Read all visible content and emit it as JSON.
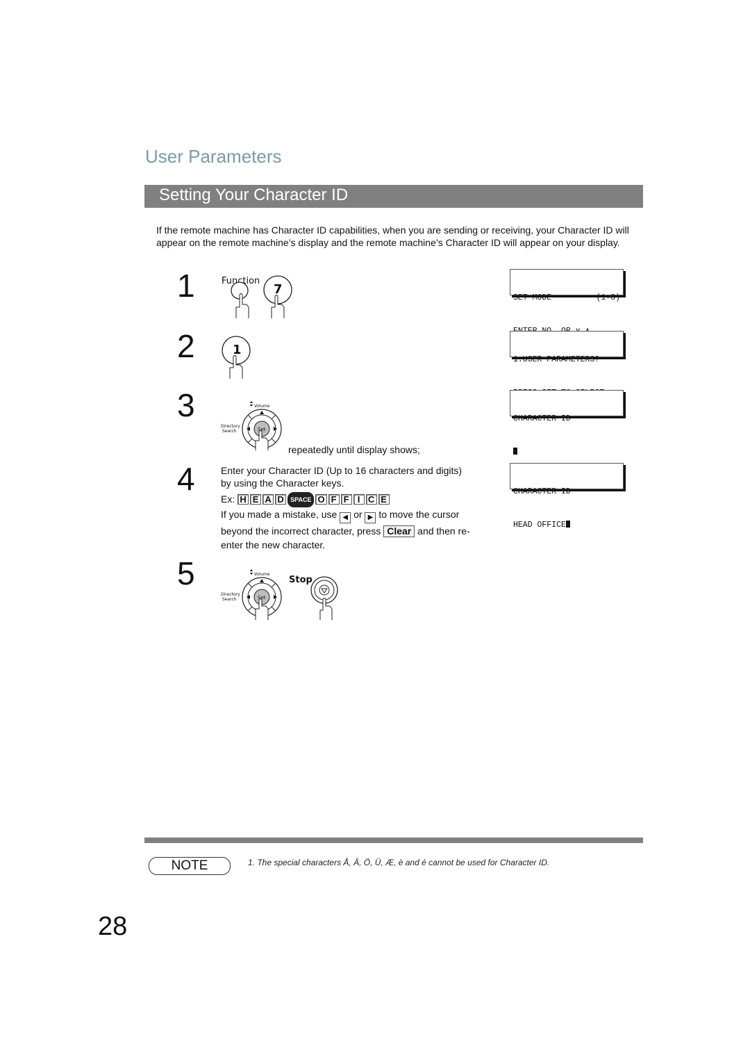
{
  "header": {
    "section_title": "User Parameters",
    "page_title": "Setting Your Character ID"
  },
  "intro": "If the remote machine has Character ID capabilities, when you are sending or receiving, your Character ID will appear on the remote machine’s display and the remote machine’s Character ID will appear on your display.",
  "steps": [
    {
      "number": "1",
      "buttons": {
        "function_label": "Function",
        "digit": "7"
      },
      "display": {
        "line1_left": "SET MODE",
        "line1_right": "(1-8)",
        "line2": "ENTER NO. OR ∨ ∧"
      }
    },
    {
      "number": "2",
      "buttons": {
        "digit": "1"
      },
      "display": {
        "line1": "1:USER PARAMETERS?",
        "line2": "PRESS SET TO SELECT"
      }
    },
    {
      "number": "3",
      "nav_labels": {
        "volume": "Volume",
        "directory": "Directory",
        "search": "Search",
        "set": "Set"
      },
      "instruction": "repeatedly until display shows;",
      "display": {
        "line1": "CHARACTER ID",
        "line2": ""
      }
    },
    {
      "number": "4",
      "instruction_line1": "Enter your Character ID (Up to 16 characters and digits)",
      "instruction_line2": "by using the Character keys.",
      "example_prefix": "Ex:",
      "example_keys": [
        "H",
        "E",
        "A",
        "D",
        "SPACE",
        "O",
        "F",
        "F",
        "I",
        "C",
        "E"
      ],
      "mistake_text_1": "If you made a mistake, use",
      "mistake_or": "or",
      "mistake_text_2": "to move the cursor",
      "mistake_text_3": "beyond the incorrect character, press",
      "clear_key": "Clear",
      "mistake_text_4": "and then re-",
      "mistake_text_5": "enter the new character.",
      "left_arrow": "◀",
      "right_arrow": "▶",
      "display": {
        "line1": "CHARACTER ID",
        "line2": "HEAD OFFICE"
      }
    },
    {
      "number": "5",
      "nav_labels": {
        "volume": "Volume",
        "directory": "Directory",
        "search": "Search",
        "set": "Set"
      },
      "stop_label": "Stop"
    }
  ],
  "note": {
    "badge": "NOTE",
    "text": "1.  The special characters Å, Ä, Ö, Ü, Æ, è and é cannot be used for Character ID."
  },
  "page_number": "28"
}
